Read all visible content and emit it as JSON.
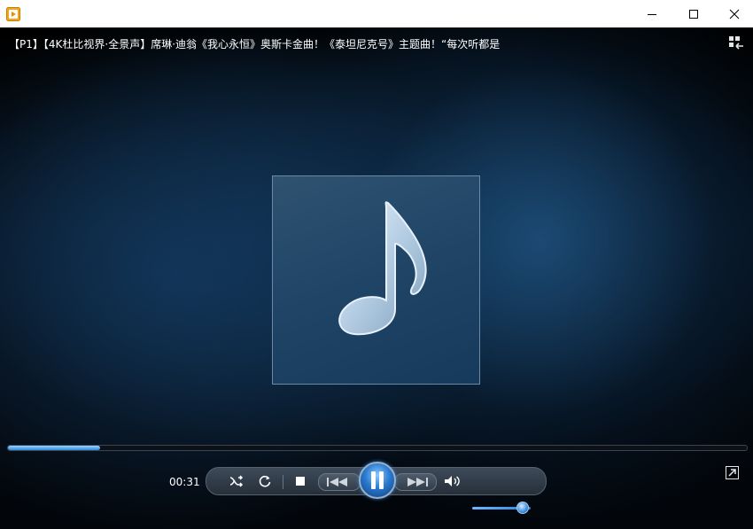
{
  "window": {
    "title_bar_title": "",
    "buttons": [
      "minimize",
      "maximize",
      "close"
    ]
  },
  "player": {
    "media_title": "【P1】【4K杜比视界·全景声】席琳·迪翁《我心永恒》奥斯卡金曲！《泰坦尼克号》主题曲！“每次听都是",
    "elapsed": "00:31",
    "progress_fraction": 0.125,
    "volume_fraction": 0.85,
    "state": "playing"
  },
  "icons": {
    "app": "media-player-icon",
    "switch_view": "switch-to-library-icon",
    "shuffle": "shuffle-icon",
    "repeat": "repeat-icon",
    "stop": "stop-icon",
    "previous": "previous-icon",
    "play_pause": "pause-icon",
    "next": "next-icon",
    "mute": "volume-icon",
    "fullscreen": "fullscreen-icon",
    "album_art": "music-note-icon"
  },
  "colors": {
    "accent": "#2a7ad0",
    "background": "#000000",
    "titlebar": "#ffffff"
  }
}
